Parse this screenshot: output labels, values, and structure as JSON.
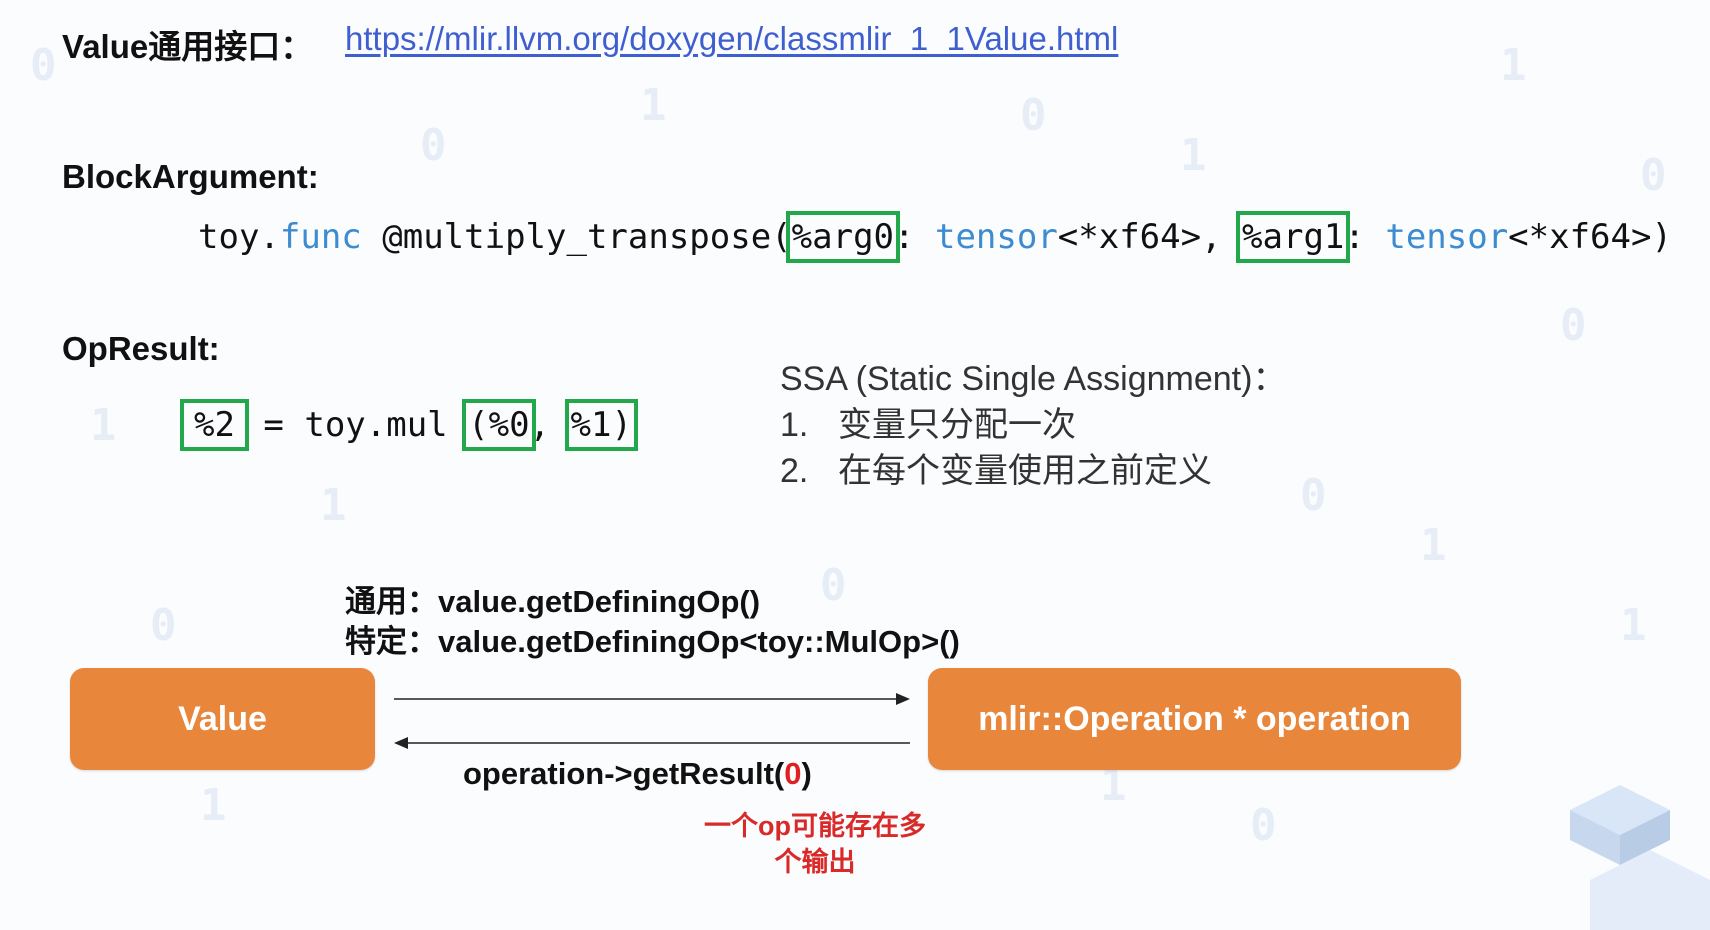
{
  "header": {
    "label": "Value通用接口：",
    "link": "https://mlir.llvm.org/doxygen/classmlir_1_1Value.html"
  },
  "block_argument": {
    "title": "BlockArgument:",
    "code": {
      "prefix": "toy.",
      "func_kw": "func",
      "func_name": " @multiply_transpose(",
      "arg0": "%arg0",
      "sep0": ": ",
      "type0_kw": "tensor",
      "type0_rest": "<*xf64>, ",
      "arg1": "%arg1",
      "sep1": ": ",
      "type1_kw": "tensor",
      "type1_rest": "<*xf64>)"
    }
  },
  "op_result": {
    "title": "OpResult:",
    "code": {
      "result": "%2",
      "assign": " = toy.mul ",
      "op0": "(%0",
      "comma": ",",
      "op1": "%1)"
    }
  },
  "ssa": {
    "title": "SSA (Static Single Assignment)：",
    "items": [
      {
        "num": "1.",
        "text": "变量只分配一次"
      },
      {
        "num": "2.",
        "text": "在每个变量使用之前定义"
      }
    ]
  },
  "diagram": {
    "general_call": "通用：value.getDefiningOp()",
    "specific_call": "特定：value.getDefiningOp<toy::MulOp>()",
    "value_box": "Value",
    "operation_box": "mlir::Operation * operation",
    "get_result_prefix": "operation->getResult(",
    "get_result_arg": "0",
    "get_result_suffix": ")",
    "note_line1": "一个op可能存在多",
    "note_line2": "个输出"
  },
  "colors": {
    "box_orange": "#e8873c",
    "highlight_green": "#22a84a",
    "keyword_blue": "#3d8bd0",
    "note_red": "#d92a2a",
    "link_blue": "#3f5fd0"
  }
}
